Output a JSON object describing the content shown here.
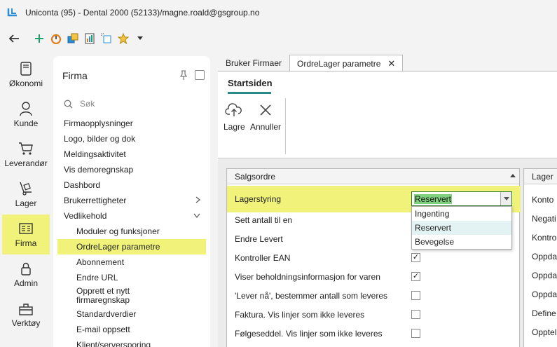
{
  "title": "Uniconta (95)  - Dental 2000 (52133)/magne.roald@gsgroup.no",
  "nav": [
    {
      "label": "Økonomi",
      "icon": "book-icon",
      "active": false
    },
    {
      "label": "Kunde",
      "icon": "person-icon",
      "active": false
    },
    {
      "label": "Leverandør",
      "icon": "cart-icon",
      "active": false
    },
    {
      "label": "Lager",
      "icon": "hand-truck-icon",
      "active": false
    },
    {
      "label": "Firma",
      "icon": "company-icon",
      "active": true
    },
    {
      "label": "Admin",
      "icon": "lock-icon",
      "active": false
    },
    {
      "label": "Verktøy",
      "icon": "toolbox-icon",
      "active": false
    }
  ],
  "panel": {
    "title": "Firma",
    "search_placeholder": "Søk",
    "items": [
      "Firmaopplysninger",
      "Logo, bilder og dok",
      "Meldingsaktivitet",
      "Vis demoregnskap",
      "Dashbord",
      "Brukerrettigheter",
      "Vedlikehold"
    ],
    "subitems": [
      "Moduler og funksjoner",
      "OrdreLager parametre",
      "Abonnement",
      "Endre URL",
      "Opprett et nytt firmaregnskap",
      "Standardverdier",
      "E-mail oppsett",
      "Klient/serversporing"
    ]
  },
  "tabs": [
    "Bruker Firmaer",
    "OrdreLager parametre"
  ],
  "ribbon": {
    "tab": "Startsiden",
    "save": "Lagre",
    "cancel": "Annuller"
  },
  "salgsordre": {
    "header": "Salgsordre",
    "lagerstyring_label": "Lagerstyring",
    "lagerstyring_value": "Reservert",
    "options": [
      "Ingenting",
      "Reservert",
      "Bevegelse"
    ],
    "rows": [
      {
        "label": "Sett antall til en",
        "checked": false
      },
      {
        "label": "Endre Levert",
        "checked": false
      },
      {
        "label": "Kontroller EAN",
        "checked": true
      },
      {
        "label": "Viser beholdningsinformasjon for varen",
        "checked": true
      },
      {
        "label": "'Lever nå', bestemmer antall som leveres",
        "checked": false
      },
      {
        "label": "Faktura. Vis linjer som ikke leveres",
        "checked": false
      },
      {
        "label": "Følgeseddel. Vis linjer som ikke leveres",
        "checked": false
      }
    ]
  },
  "lager": {
    "header": "Lager",
    "rows": [
      "Konto",
      "Negati",
      "Kontrol",
      "Oppda",
      "Oppda",
      "Oppda",
      "Define",
      "Oppteli"
    ]
  }
}
